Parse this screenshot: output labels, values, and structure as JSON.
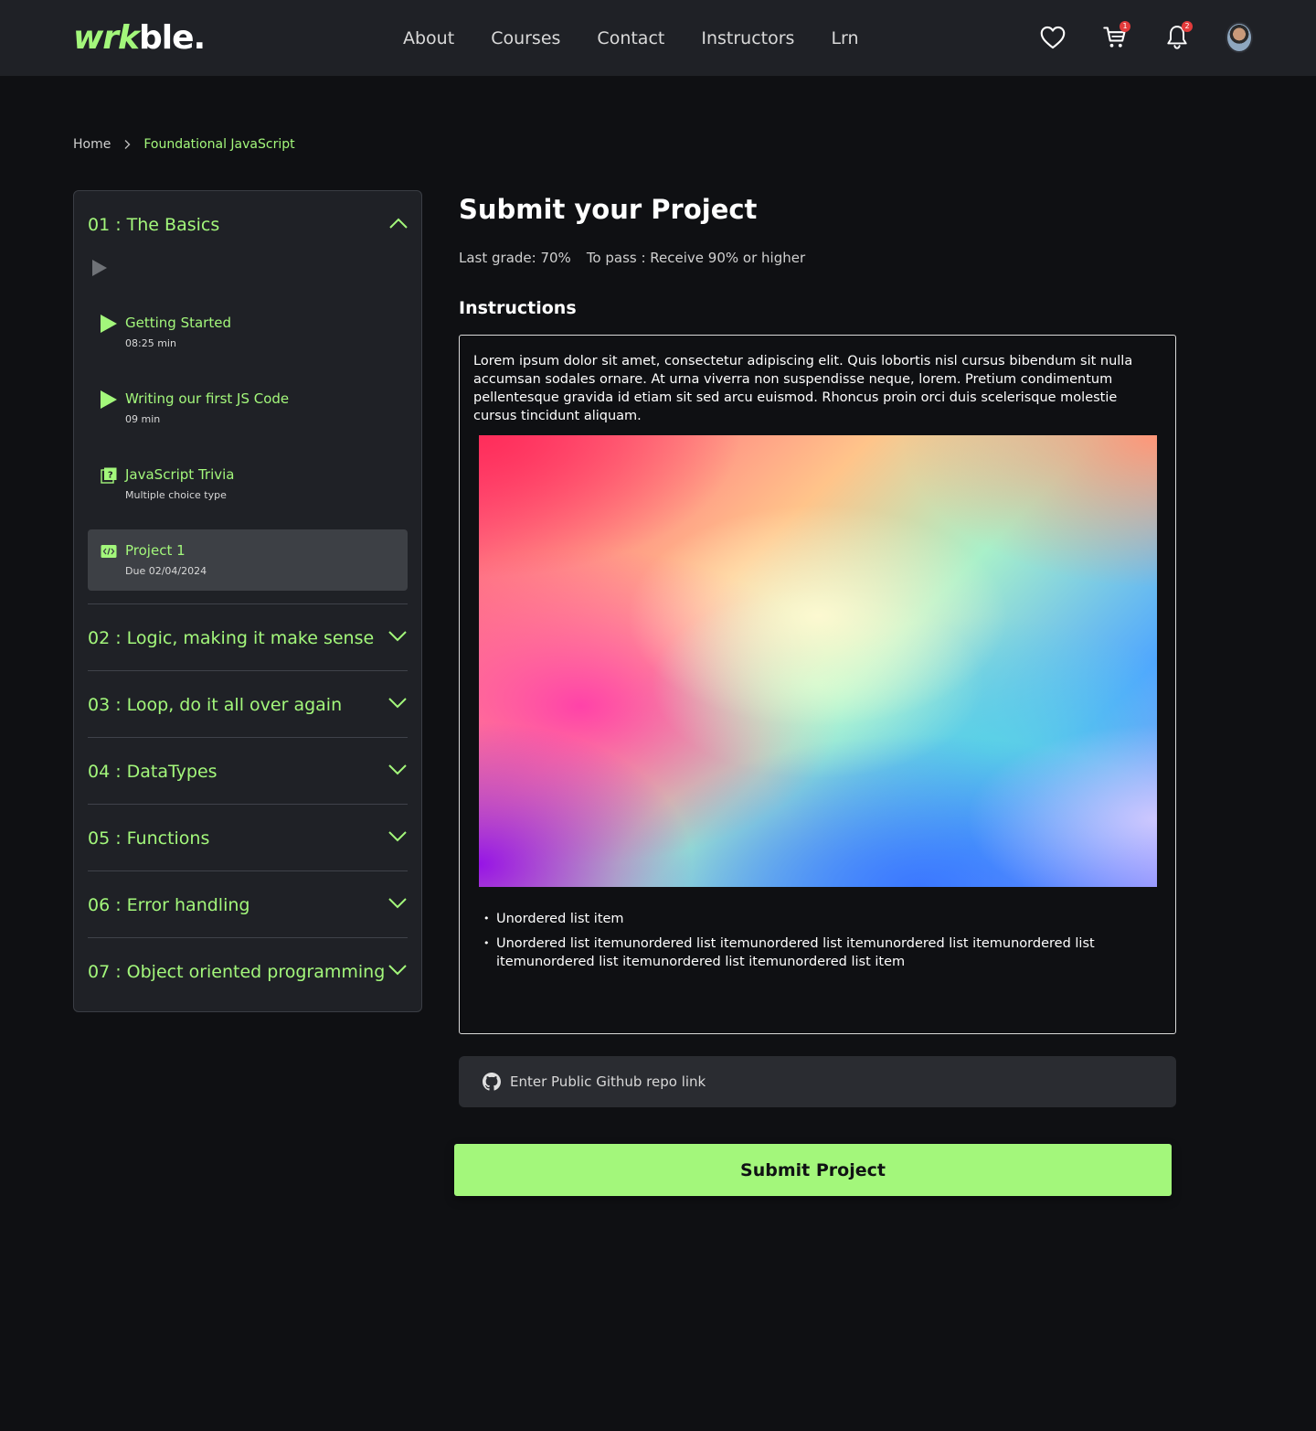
{
  "header": {
    "logo_a": "wrk",
    "logo_b": "ble.",
    "nav": [
      "About",
      "Courses",
      "Contact",
      "Instructors",
      "Lrn"
    ],
    "cart_badge": "1",
    "notifications_badge": "2"
  },
  "breadcrumb": {
    "home": "Home",
    "current": "Foundational JavaScript"
  },
  "sidebar": {
    "open_module": {
      "title": "01 : The Basics",
      "lessons": [
        {
          "title": "Getting Started",
          "sub": "08:25 min",
          "icon": "play-icon"
        },
        {
          "title": "Writing our first JS Code",
          "sub": "09 min",
          "icon": "play-icon"
        },
        {
          "title": "JavaScript Trivia",
          "sub": "Multiple choice type",
          "icon": "quiz-icon"
        },
        {
          "title": "Project 1",
          "sub": "Due 02/04/2024",
          "icon": "code-icon"
        }
      ]
    },
    "modules": [
      "02 : Logic, making it make sense",
      "03 : Loop, do it all over again",
      "04 : DataTypes",
      "05 : Functions",
      "06 : Error handling",
      "07 : Object oriented programming"
    ]
  },
  "main": {
    "title": "Submit your Project",
    "last_grade": "Last grade: 70%",
    "to_pass": "To pass : Receive 90% or higher",
    "instructions_heading": "Instructions",
    "instructions_text": "Lorem ipsum dolor sit amet, consectetur adipiscing elit. Quis lobortis nisl cursus bibendum sit nulla accumsan sodales ornare. At urna viverra non suspendisse neque, lorem. Pretium condimentum pellentesque gravida id etiam sit sed arcu euismod. Rhoncus proin orci duis scelerisque molestie cursus tincidunt aliquam.",
    "bullets": [
      "Unordered list item",
      "Unordered list itemunordered list itemunordered list itemunordered list itemunordered list itemunordered list itemunordered list itemunordered list item"
    ],
    "github_placeholder": "Enter Public Github repo link",
    "submit_label": "Submit Project"
  },
  "colors": {
    "accent": "#a3f77b",
    "background": "#0f1013",
    "panel": "#1f2126",
    "active_lesson": "#3d4045"
  }
}
